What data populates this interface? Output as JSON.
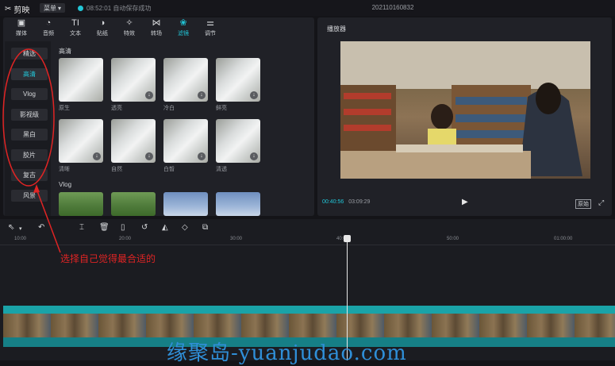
{
  "app": {
    "name": "剪映",
    "menu": "菜单",
    "autosave": "08:52:01 自动保存成功",
    "project_title": "202110160832"
  },
  "toolbar": [
    {
      "label": "媒体",
      "icon": "media-icon",
      "glyph": "▣"
    },
    {
      "label": "音频",
      "icon": "audio-icon",
      "glyph": "◔"
    },
    {
      "label": "文本",
      "icon": "text-icon",
      "glyph": "TI"
    },
    {
      "label": "贴纸",
      "icon": "sticker-icon",
      "glyph": "◑"
    },
    {
      "label": "特效",
      "icon": "effects-icon",
      "glyph": "✧"
    },
    {
      "label": "转场",
      "icon": "transition-icon",
      "glyph": "⋈"
    },
    {
      "label": "滤镜",
      "icon": "filter-icon",
      "glyph": "❀",
      "active": true
    },
    {
      "label": "调节",
      "icon": "adjust-icon",
      "glyph": "⚌"
    }
  ],
  "sidebar": [
    {
      "label": "精选"
    },
    {
      "label": "高清",
      "active": true
    },
    {
      "label": "Vlog"
    },
    {
      "label": "影视级"
    },
    {
      "label": "黑白"
    },
    {
      "label": "胶片"
    },
    {
      "label": "复古"
    },
    {
      "label": "风景"
    }
  ],
  "filters": {
    "section1": "高清",
    "row1": [
      "原生",
      "透亮",
      "冷白",
      "鲜亮"
    ],
    "row2": [
      "清晰",
      "自然",
      "白皙",
      "清透"
    ],
    "section2": "Vlog"
  },
  "player": {
    "title": "播放器",
    "current_time": "00:40:56",
    "total_time": "03:09:29",
    "ratio_label": "原始"
  },
  "timeline": {
    "ticks": [
      "10:00",
      "20:00",
      "30:00",
      "40:00",
      "50:00",
      "01:00:00"
    ]
  },
  "annotation": "选择自己觉得最合适的",
  "watermark": "缘聚岛-yuanjudao.com",
  "colors": {
    "accent": "#21c6d8",
    "annotation": "#e02424",
    "watermark": "#2f8fd8"
  }
}
